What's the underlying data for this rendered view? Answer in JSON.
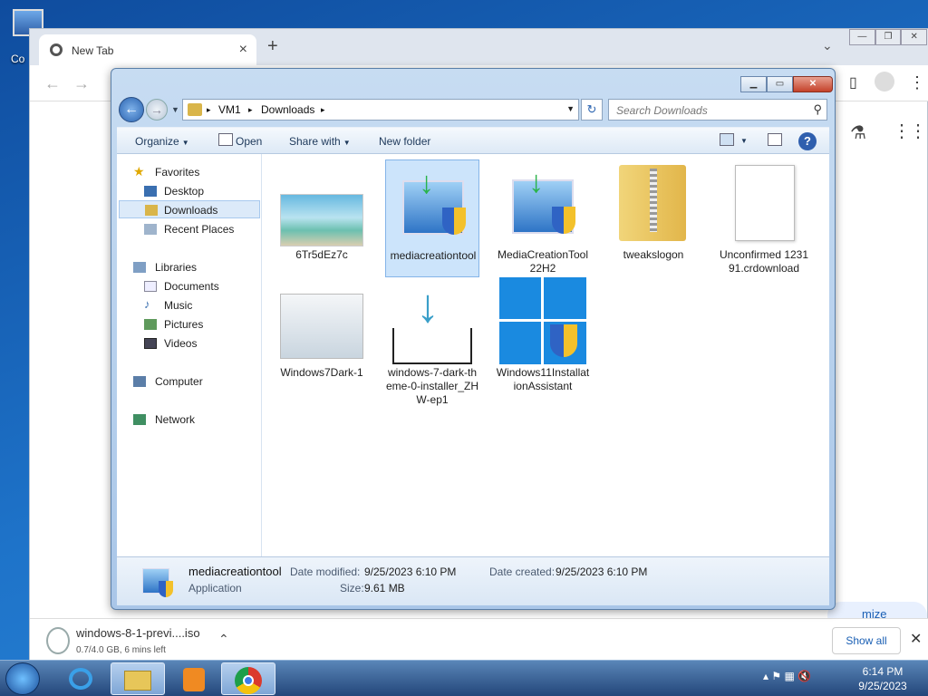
{
  "desktop": {
    "icon_label": "Co"
  },
  "chrome": {
    "tab_title": "New Tab",
    "tab_close": "×",
    "new_tab": "+",
    "tab_search": "⌄",
    "win_min": "—",
    "win_max": "❐",
    "win_close": "✕",
    "back": "←",
    "forward": "→",
    "side_panel": "▯",
    "menu": "⋮",
    "labs_icon": "⚗",
    "apps_icon": "⋮⋮⋮",
    "customize": "mize Chrome",
    "download": {
      "name": "windows-8-1-previ....iso",
      "status": "0.7/4.0 GB, 6 mins left",
      "caret": "⌃",
      "show_all": "Show all",
      "close": "✕"
    }
  },
  "explorer": {
    "caption": {
      "min": "▁",
      "max": "▭",
      "close": "✕"
    },
    "back": "←",
    "forward": "→",
    "recent_caret": "▼",
    "breadcrumbs": [
      "VM1",
      "Downloads"
    ],
    "sep": "▸",
    "addr_drop": "▼",
    "refresh": "↻",
    "search_placeholder": "Search Downloads",
    "search_icon": "⚲",
    "commands": {
      "organize": "Organize",
      "open": "Open",
      "share_with": "Share with",
      "new_folder": "New folder",
      "caret": "▼",
      "help": "?"
    },
    "nav": {
      "favorites": "Favorites",
      "desktop": "Desktop",
      "downloads": "Downloads",
      "recent_places": "Recent Places",
      "libraries": "Libraries",
      "documents": "Documents",
      "music": "Music",
      "pictures": "Pictures",
      "videos": "Videos",
      "computer": "Computer",
      "network": "Network"
    },
    "files": [
      {
        "name": "6Tr5dEz7c"
      },
      {
        "name": "mediacreationtool"
      },
      {
        "name": "MediaCreationTool22H2"
      },
      {
        "name": "tweakslogon"
      },
      {
        "name": "Unconfirmed 123191.crdownload"
      },
      {
        "name": "Windows7Dark-1"
      },
      {
        "name": "windows-7-dark-theme-0-installer_ZHW-ep1"
      },
      {
        "name": "Windows11InstallationAssistant"
      }
    ],
    "details": {
      "name": "mediacreationtool",
      "type": "Application",
      "date_modified_label": "Date modified:",
      "date_modified": "9/25/2023 6:10 PM",
      "date_created_label": "Date created:",
      "date_created": "9/25/2023 6:10 PM",
      "size_label": "Size:",
      "size": "9.61 MB"
    }
  },
  "taskbar": {
    "tray_icons": "▴ ⚑ ▦ 🔇",
    "time": "6:14 PM",
    "date": "9/25/2023"
  }
}
